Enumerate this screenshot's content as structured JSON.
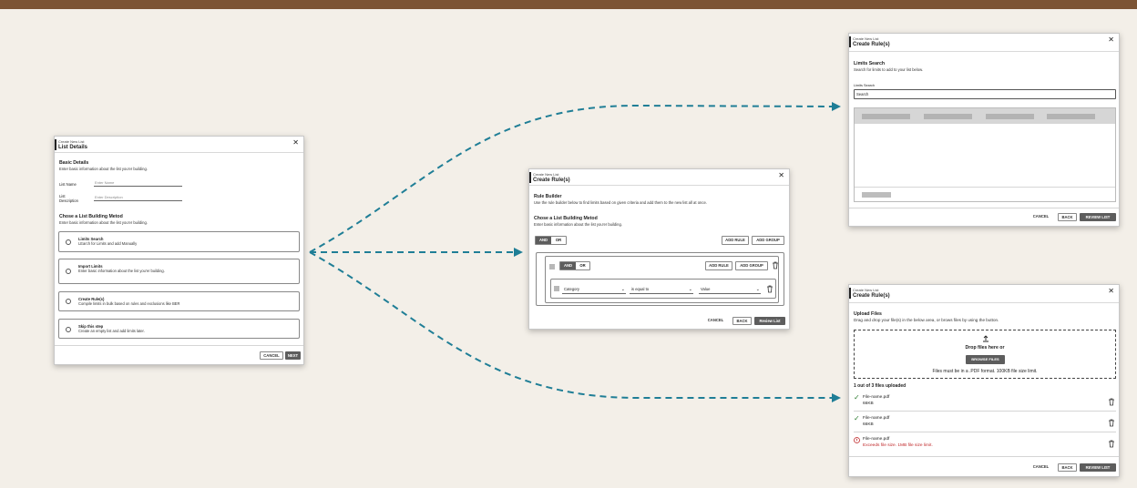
{
  "colors": {
    "topbar": "#7c5434",
    "background": "#f3efe8",
    "connector": "#1f7e96",
    "primary_button": "#5d5d5d",
    "error": "#c0282a"
  },
  "list_details": {
    "subtitle": "Create New List",
    "title": "List Details",
    "basic_title": "Basic Details",
    "basic_desc": "Enter basic information about the list you'er building.",
    "name_label": "List Name",
    "name_placeholder": "Enter Name",
    "desc_label_1": "List",
    "desc_label_2": "Description",
    "desc_placeholder": "Enter Description",
    "method_title": "Chose a List Building Metod",
    "method_desc": "Enter basic information about the list you'er building.",
    "options": [
      {
        "title": "Limits Search",
        "desc": "LEarch for Limits and add Manually"
      },
      {
        "title": "Import Limits",
        "desc": "Enter basic information about the list you'er building."
      },
      {
        "title": "Create Rule(s)",
        "desc": "Compile limits in bulk based on rules and exclusions like BER"
      },
      {
        "title": "Skip this step",
        "desc": "Create an empty list and add limits later."
      }
    ],
    "cancel": "CANCEL",
    "next": "NEXT"
  },
  "rule_builder": {
    "subtitle": "Create New List",
    "title": "Create Rule(s)",
    "rb_title": "Rule Builder",
    "rb_desc": "Use the rule builder below to find limits based on given criteria and add them to the new list all at once.",
    "method_title": "Chose a List Building Metod",
    "method_desc": "Enter basic information about the list you'er building.",
    "and": "AND",
    "or": "OR",
    "add_rule": "ADD RULE",
    "add_group": "ADD GROUP",
    "field_select": "Category",
    "operator_select": "is equal to",
    "value_select": "Value",
    "cancel": "CANCEL",
    "back": "BACK",
    "review": "Review List"
  },
  "limits_search": {
    "subtitle": "Create New List",
    "title": "Create Rule(s)",
    "section_title": "Limits Search",
    "section_desc": "Search for limits to add  to your list below.",
    "field_label": "Limits Search",
    "field_value": "Search",
    "cancel": "CANCEL",
    "back": "BACK",
    "review": "REVIEW LIST"
  },
  "upload": {
    "subtitle": "Create New List",
    "title": "Create Rule(s)",
    "section_title": "Upload Files",
    "section_desc": "Drag and drop your file(s) in the below area, or brows files by using the button.",
    "drop_text": "Drop files here or",
    "browse": "BROWSE FILES",
    "format_note": "Files must be in a .PDF format. 100KB file size limit.",
    "status": "1 out of 3 files uploaded",
    "files": [
      {
        "name": "File-name.pdf",
        "detail": "66KB",
        "state": "ok"
      },
      {
        "name": "File-name.pdf",
        "detail": "66KB",
        "state": "ok"
      },
      {
        "name": "File-name.pdf",
        "detail": "Exceeds file size. 1MB file size limit.",
        "state": "error"
      }
    ],
    "cancel": "CANCEL",
    "back": "BACK",
    "review": "REVIEW LIST"
  }
}
